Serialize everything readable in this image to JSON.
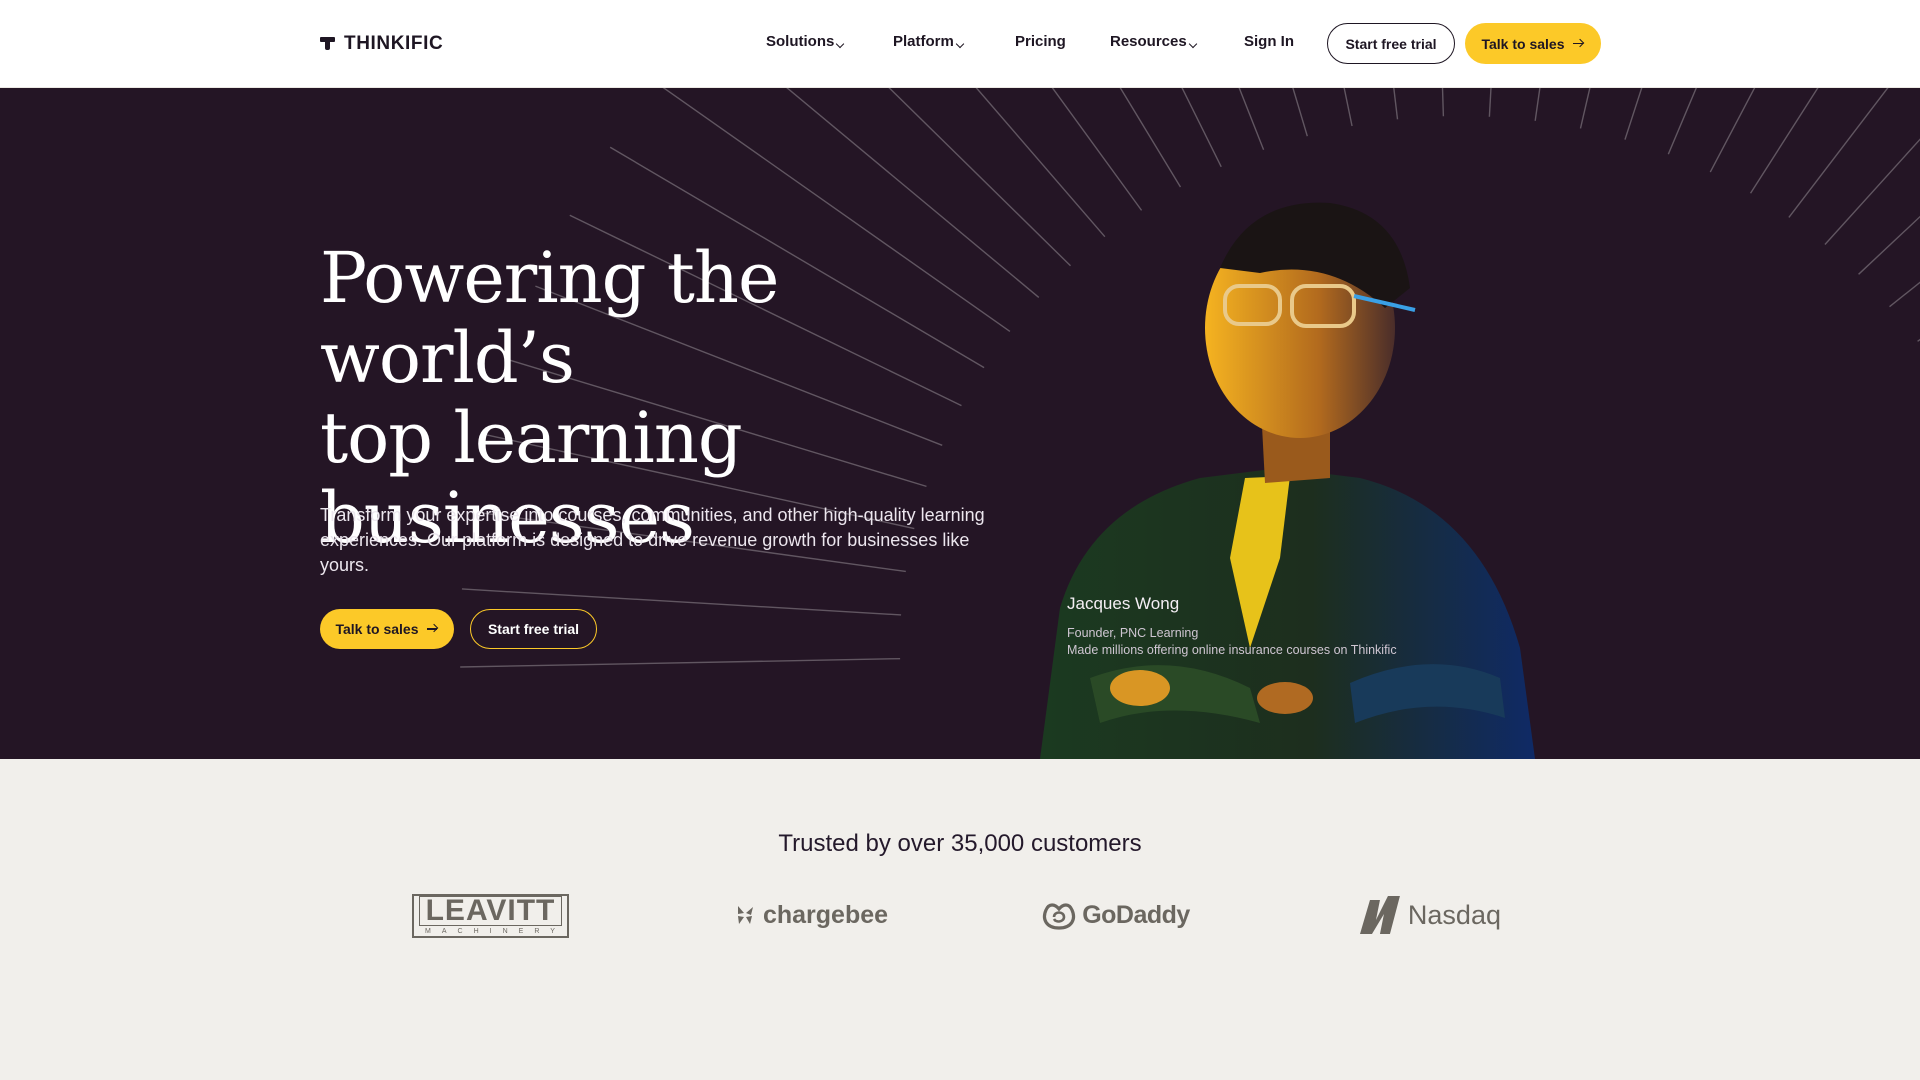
{
  "nav": {
    "logo_text": "THINKIFIC",
    "items": [
      {
        "label": "Solutions",
        "has_dropdown": true
      },
      {
        "label": "Platform",
        "has_dropdown": true
      },
      {
        "label": "Pricing",
        "has_dropdown": false
      },
      {
        "label": "Resources",
        "has_dropdown": true
      },
      {
        "label": "Sign In",
        "has_dropdown": false
      }
    ],
    "start_trial_label": "Start free trial",
    "talk_sales_label": "Talk to sales"
  },
  "hero": {
    "title_line1": "Powering the world’s",
    "title_line2": "top learning",
    "title_line3": "businesses",
    "subtitle": "Transform your expertise into courses, communities, and other high-quality learning experiences. Our platform is designed to drive revenue growth for businesses like yours.",
    "primary_button": "Talk to sales",
    "secondary_button": "Start free trial",
    "testimonial": {
      "name": "Jacques Wong",
      "role": "Founder, PNC Learning",
      "description": "Made millions offering online insurance courses on Thinkific"
    }
  },
  "trusted": {
    "heading": "Trusted by over 35,000 customers",
    "logos": [
      {
        "name": "LEAVITT",
        "subtext": "MACHINERY"
      },
      {
        "name": "chargebee"
      },
      {
        "name": "GoDaddy"
      },
      {
        "name": "Nasdaq"
      }
    ]
  },
  "colors": {
    "hero_bg": "#241525",
    "accent_yellow": "#fcc928",
    "page_bg": "#f1efeb",
    "text_dark": "#1e1623"
  }
}
